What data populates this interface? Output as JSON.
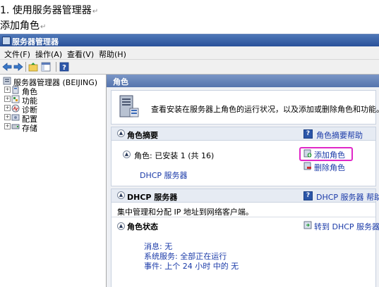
{
  "document": {
    "line1": "1.   使用服务器管理器",
    "line2": "添加角色",
    "paragraph_mark": "↵"
  },
  "window": {
    "title": "服务器管理器",
    "menu": [
      "文件(F)",
      "操作(A)",
      "查看(V)",
      "帮助(H)"
    ]
  },
  "tree": {
    "root": "服务器管理器 (BEIJING)",
    "items": [
      "角色",
      "功能",
      "诊断",
      "配置",
      "存储"
    ]
  },
  "main": {
    "header": "角色",
    "description": "查看安装在服务器上角色的运行状况，以及添加或删除角色和功能。",
    "role_summary": {
      "title": "角色摘要",
      "help_link": "角色摘要帮助",
      "roles_label": "角色: 已安装 1 (共 16)",
      "role_item": "DHCP 服务器",
      "add_role": "添加角色",
      "remove_role": "删除角色"
    },
    "dhcp": {
      "title": "DHCP 服务器",
      "help_link": "DHCP 服务器 帮助",
      "description": "集中管理和分配 IP 地址到网络客户端。",
      "status_title": "角色状态",
      "goto_link": "转到 DHCP 服务器",
      "message": "消息: 无",
      "services": "系统服务: 全部正在运行",
      "events": "事件: 上个 24 小时 中的 无"
    }
  },
  "colors": {
    "highlight": "#e028c8",
    "link": "#1a3aa8",
    "titlebar": "#2a5199"
  }
}
